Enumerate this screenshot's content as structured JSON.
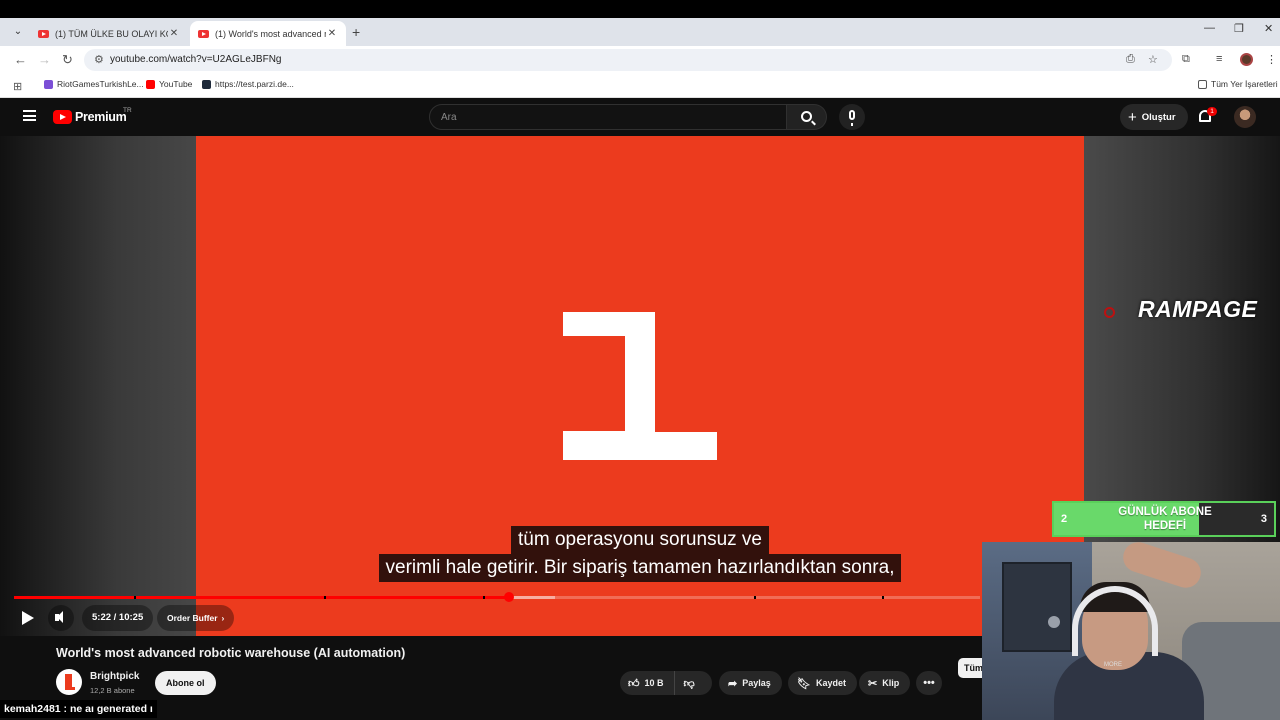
{
  "browser": {
    "tabs": [
      {
        "title": "(1) TÜM ÜLKE BU OLAYI KONUŞ",
        "active": false
      },
      {
        "title": "(1) World's most advanced robo",
        "active": true
      }
    ],
    "new_tab": "+",
    "url": "youtube.com/watch?v=U2AGLeJBFNg",
    "bookmarks": [
      {
        "label": "RiotGamesTurkishLe...",
        "color": "#7b4fd6"
      },
      {
        "label": "YouTube",
        "color": "#ff0000"
      },
      {
        "label": "https://test.parzi.de...",
        "color": "#1e2a3a"
      }
    ],
    "all_bookmarks": "Tüm Yer İşaretleri",
    "window_controls": {
      "minimize": "—",
      "maximize": "❐",
      "close": "✕"
    }
  },
  "masthead": {
    "wordmark": "Premium",
    "country": "TR",
    "search_placeholder": "Ara",
    "create_label": "Oluştur",
    "notification_count": "1"
  },
  "video": {
    "subtitle_lines": [
      "tüm operasyonu sorunsuz ve",
      "verimli hale getirir.  Bir sipariş tamamen hazırlandıktan sonra,"
    ],
    "time": "5:22 / 10:25",
    "chapter": "Order Buffer",
    "progress_fraction": 0.5125,
    "buffer_fraction": 0.56,
    "title": "World's most advanced robotic warehouse (AI automation)",
    "channel_name": "Brightpick",
    "channel_subs": "12,2 B abone",
    "subscribe_label": "Abone ol",
    "likes": "10 B",
    "share_label": "Paylaş",
    "save_label": "Kaydet",
    "clip_label": "Klip",
    "more_label": "•••",
    "side_pill": "Tüm"
  },
  "overlay": {
    "rampage": "RAMPAGE",
    "goal": {
      "left": "2",
      "text": "GÜNLÜK ABONE HEDEFİ",
      "right": "3",
      "fill_fraction": 0.66
    },
    "webcam_text": "MORE",
    "chat_user": "kemah2481",
    "chat_message": " : ne aı generated ı"
  },
  "colors": {
    "video_bg": "#ec3b1e",
    "accent_red": "#ff0000",
    "goal_green": "#69d96a"
  }
}
